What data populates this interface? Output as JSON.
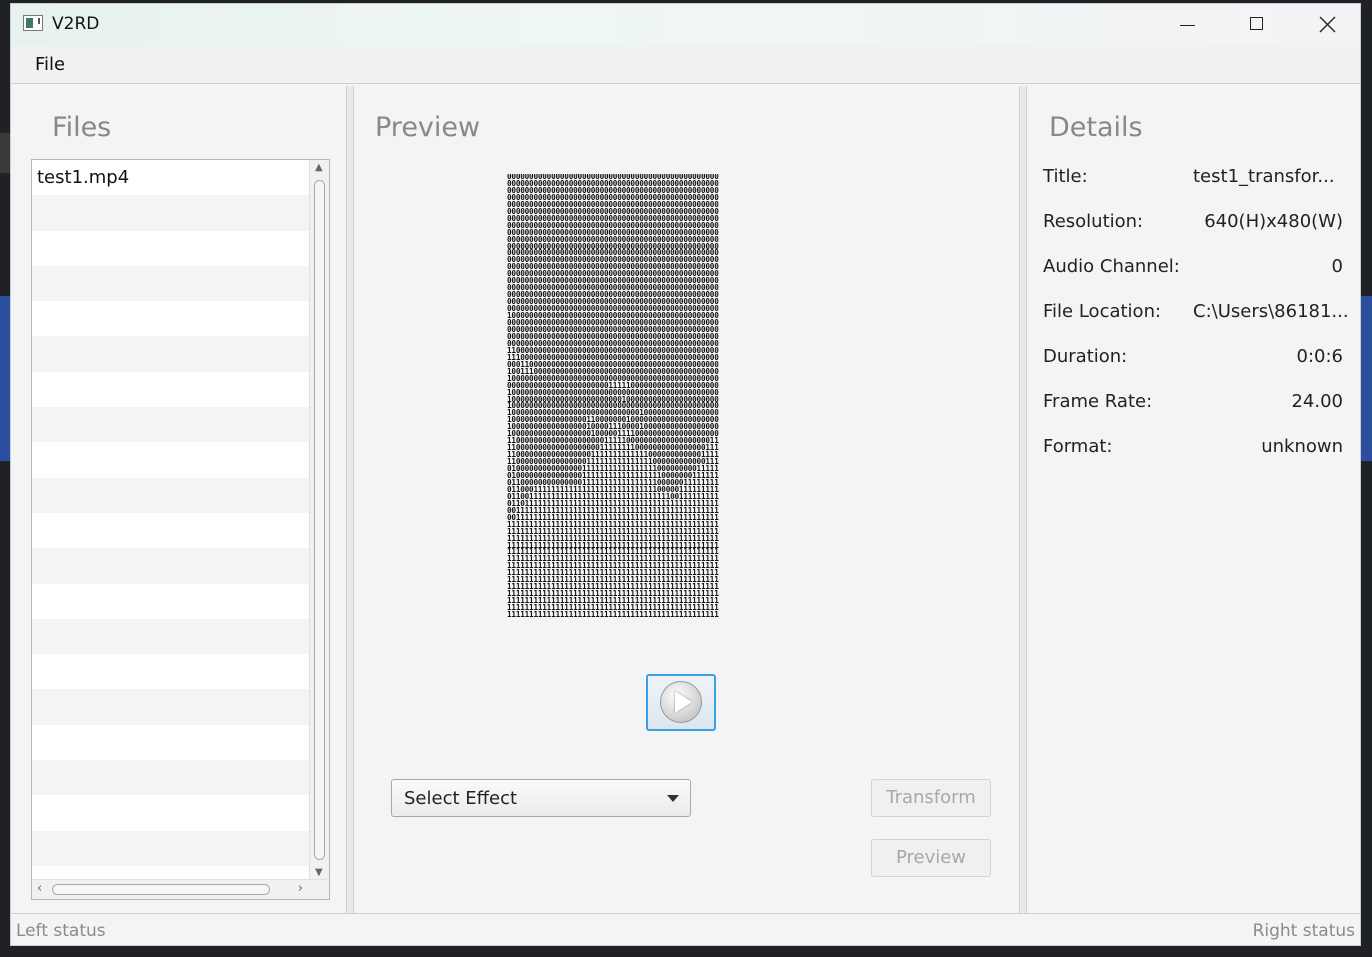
{
  "window": {
    "title": "V2RD"
  },
  "menu": {
    "items": [
      "File"
    ]
  },
  "files": {
    "heading": "Files",
    "items": [
      "test1.mp4"
    ]
  },
  "preview": {
    "heading": "Preview",
    "ascii_frame": [
      "000000000000000000000000000000000000000000000000",
      "000000000000000000000000000000000000000000000000",
      "000000000000000000000000000000000000000000000000",
      "000000000000000000000000000000000000000000000000",
      "000000000000000000000000000000000000000000000000",
      "000000000000000000000000000000000000000000000000",
      "000000000000000000000000000000000000000000000000",
      "000000000000000000000000000000000000000000000000",
      "000000000000000000000000000000000000000000000000",
      "000000000000000000000000000000000000000000000000",
      "000000000000000000000000000000000000000000000000",
      "000000000000000000000000000000000000000000000000",
      "000000000000000000000000000000000000000000000000",
      "000000000000000000000000000000000000000000000000",
      "000000000000000000000000000000000000000000000000",
      "000000000000000000000000000000000000000000000000",
      "000000000000000000000000000000000000000000000000",
      "000000000000000000000000000000000000000000000000",
      "000000000000000000000000000000000000000000000000",
      "000000000000000000000000000000000000000000000000",
      "100000000000000000000000000000000000000000000000",
      "000000000000000000000000000000000000000000000000",
      "000000000000000000000000000000000000000000000000",
      "000000000000000000000000000000000000000000000000",
      "000000000000000000000000000000000000000000000000",
      "110000000000000000000000000000000000000000000000",
      "111000000000000000000000000000000000000000000000",
      "000110000000000000000000000000000000000000000000",
      "100111000000000000000000000000000000000000000000",
      "100000000000000000000000000000000000000000000000",
      "000000000000000000000001111100000000000000000000",
      "100000000000000000000000000000000000000000000000",
      "100000000000000000000000001000000000000000000000",
      "100000000000000000000000000000000000000000000000",
      "100000000000000000000000000000100000000000000000",
      "100000000000000000110000000100000000000000000000",
      "100000000000000000100001110000100000000000000000",
      "100000000000000000010000011110000000000000000000",
      "110000000000000000000011111000000000000000000011",
      "110000000000000000000111111110000000000000000111",
      "110000000000000000011111111111110000000000001111",
      "110000000000000000111111111111111000000000000111",
      "010000000000000001111111111111111100000000011111",
      "010000000000000001111111111111111110000000111111",
      "011000000000000001111111111111111100000011111111",
      "011000111111111111111111111111111100000111111111",
      "011001111111111111111111111111111111100111111111",
      "011011111111111111111111111111111111111111111111",
      "001111111111111111111111111111111111111111111111",
      "001111111111111111111111111111111111111111111111",
      "111111111111111111111111111111111111111111111111",
      "111111111111111111111111111111111111111111111111",
      "111111111111111111111111111111111111111111111111",
      "111111111111111111111111111111111111111111111111",
      "111111111111111111111111111111111111111111111111",
      "111111111111111111111111111111111111111111111111",
      "111111111111111111111111111111111111111111111111",
      "111111111111111111111111111111111111111111111111",
      "111111111111111111111111111111111111111111111111",
      "111111111111111111111111111111111111111111111111",
      "111111111111111111111111111111111111111111111111",
      "111111111111111111111111111111111111111111111111",
      "111111111111111111111111111111111111111111111111",
      "111111111111111111111111111111111111111111111111"
    ],
    "effect_select": {
      "selected": "Select Effect"
    },
    "transform_label": "Transform",
    "preview_label": "Preview"
  },
  "details": {
    "heading": "Details",
    "rows": [
      {
        "label": "Title:",
        "value": "test1_transfor..."
      },
      {
        "label": "Resolution:",
        "value": "640(H)x480(W)"
      },
      {
        "label": "Audio Channel:",
        "value": "0"
      },
      {
        "label": "File Location:",
        "value": "C:\\Users\\86181..."
      },
      {
        "label": "Duration:",
        "value": "0:0:6"
      },
      {
        "label": "Frame Rate:",
        "value": "24.00"
      },
      {
        "label": "Format:",
        "value": "unknown"
      }
    ]
  },
  "status": {
    "left": "Left status",
    "right": "Right status"
  },
  "colors": {
    "accent": "#39a0e8",
    "heading": "#888888"
  }
}
